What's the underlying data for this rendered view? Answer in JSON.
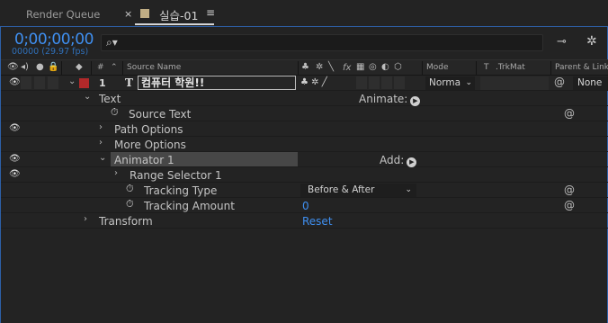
{
  "tabs": {
    "render_queue": "Render Queue",
    "comp_close": "×",
    "comp_name": "실습-01",
    "comp_menu": "≡"
  },
  "header": {
    "timecode": "0;00;00;00",
    "fps": "00000 (29.97 fps)",
    "search_placeholder": ""
  },
  "columns": {
    "hash": "#",
    "source_name": "Source Name",
    "mode": "Mode",
    "t": "T",
    "trkmat": ".TrkMat",
    "parent_link": "Parent & Link",
    "fx": "fx"
  },
  "layer": {
    "number": "1",
    "name": "컴퓨터 학원!!",
    "mode": "Norma",
    "parent": "None",
    "label_color": "#b2292a"
  },
  "rows": {
    "text": "Text",
    "animate": "Animate:",
    "source_text": "Source Text",
    "path_options": "Path Options",
    "more_options": "More Options",
    "animator_1": "Animator 1",
    "add": "Add:",
    "range_selector": "Range Selector 1",
    "tracking_type": "Tracking Type",
    "tracking_type_value": "Before & After",
    "tracking_amount": "Tracking Amount",
    "tracking_amount_value": "0",
    "transform": "Transform",
    "reset": "Reset"
  },
  "colors": {
    "accent_blue": "#3f8ff0",
    "panel_border": "#2d5fa6",
    "background": "#232323"
  }
}
